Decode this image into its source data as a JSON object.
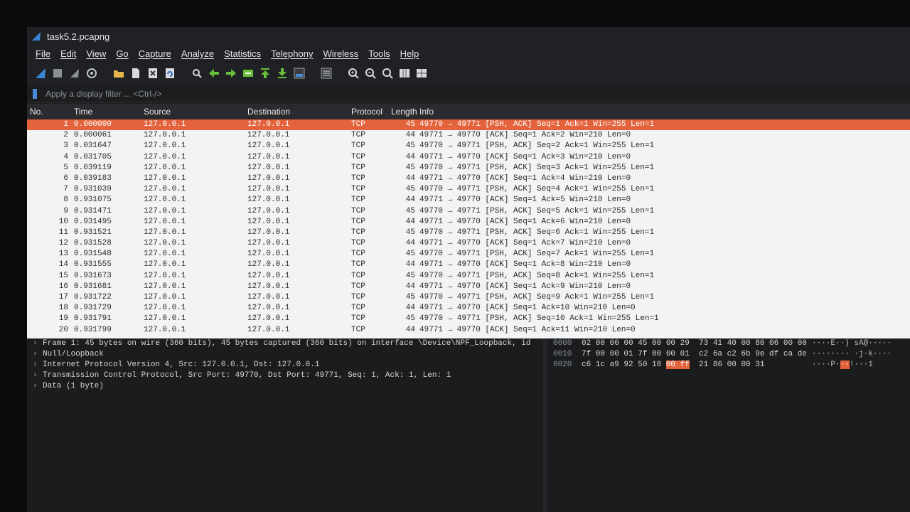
{
  "window": {
    "title": "task5.2.pcapng"
  },
  "menu": [
    "File",
    "Edit",
    "View",
    "Go",
    "Capture",
    "Analyze",
    "Statistics",
    "Telephony",
    "Wireless",
    "Tools",
    "Help"
  ],
  "toolbar": {
    "icons": [
      "shark-fin-start-icon",
      "stop-icon",
      "restart-icon",
      "options-icon",
      "open-folder-icon",
      "save-file-icon",
      "close-file-icon",
      "reload-icon",
      "find-icon",
      "back-arrow-icon",
      "forward-arrow-icon",
      "go-to-packet-icon",
      "first-packet-icon",
      "last-packet-icon",
      "autoscroll-icon",
      "colorize-icon",
      "zoom-in-icon",
      "zoom-out-icon",
      "normal-size-icon",
      "resize-columns-icon",
      "expand-icon"
    ]
  },
  "filter": {
    "placeholder": "Apply a display filter ... <Ctrl-/>"
  },
  "columns": {
    "no": "No.",
    "time": "Time",
    "source": "Source",
    "destination": "Destination",
    "protocol": "Protocol",
    "length": "Length",
    "info": "Info"
  },
  "packets": [
    {
      "no": "1",
      "time": "0.000000",
      "src": "127.0.0.1",
      "dst": "127.0.0.1",
      "proto": "TCP",
      "len": "45",
      "info": "49770 → 49771 [PSH, ACK] Seq=1 Ack=1 Win=255 Len=1"
    },
    {
      "no": "2",
      "time": "0.000061",
      "src": "127.0.0.1",
      "dst": "127.0.0.1",
      "proto": "TCP",
      "len": "44",
      "info": "49771 → 49770 [ACK] Seq=1 Ack=2 Win=210 Len=0"
    },
    {
      "no": "3",
      "time": "0.031647",
      "src": "127.0.0.1",
      "dst": "127.0.0.1",
      "proto": "TCP",
      "len": "45",
      "info": "49770 → 49771 [PSH, ACK] Seq=2 Ack=1 Win=255 Len=1"
    },
    {
      "no": "4",
      "time": "0.031705",
      "src": "127.0.0.1",
      "dst": "127.0.0.1",
      "proto": "TCP",
      "len": "44",
      "info": "49771 → 49770 [ACK] Seq=1 Ack=3 Win=210 Len=0"
    },
    {
      "no": "5",
      "time": "0.039119",
      "src": "127.0.0.1",
      "dst": "127.0.0.1",
      "proto": "TCP",
      "len": "45",
      "info": "49770 → 49771 [PSH, ACK] Seq=3 Ack=1 Win=255 Len=1"
    },
    {
      "no": "6",
      "time": "0.039183",
      "src": "127.0.0.1",
      "dst": "127.0.0.1",
      "proto": "TCP",
      "len": "44",
      "info": "49771 → 49770 [ACK] Seq=1 Ack=4 Win=210 Len=0"
    },
    {
      "no": "7",
      "time": "0.931039",
      "src": "127.0.0.1",
      "dst": "127.0.0.1",
      "proto": "TCP",
      "len": "45",
      "info": "49770 → 49771 [PSH, ACK] Seq=4 Ack=1 Win=255 Len=1"
    },
    {
      "no": "8",
      "time": "0.931075",
      "src": "127.0.0.1",
      "dst": "127.0.0.1",
      "proto": "TCP",
      "len": "44",
      "info": "49771 → 49770 [ACK] Seq=1 Ack=5 Win=210 Len=0"
    },
    {
      "no": "9",
      "time": "0.931471",
      "src": "127.0.0.1",
      "dst": "127.0.0.1",
      "proto": "TCP",
      "len": "45",
      "info": "49770 → 49771 [PSH, ACK] Seq=5 Ack=1 Win=255 Len=1"
    },
    {
      "no": "10",
      "time": "0.931495",
      "src": "127.0.0.1",
      "dst": "127.0.0.1",
      "proto": "TCP",
      "len": "44",
      "info": "49771 → 49770 [ACK] Seq=1 Ack=6 Win=210 Len=0"
    },
    {
      "no": "11",
      "time": "0.931521",
      "src": "127.0.0.1",
      "dst": "127.0.0.1",
      "proto": "TCP",
      "len": "45",
      "info": "49770 → 49771 [PSH, ACK] Seq=6 Ack=1 Win=255 Len=1"
    },
    {
      "no": "12",
      "time": "0.931528",
      "src": "127.0.0.1",
      "dst": "127.0.0.1",
      "proto": "TCP",
      "len": "44",
      "info": "49771 → 49770 [ACK] Seq=1 Ack=7 Win=210 Len=0"
    },
    {
      "no": "13",
      "time": "0.931548",
      "src": "127.0.0.1",
      "dst": "127.0.0.1",
      "proto": "TCP",
      "len": "45",
      "info": "49770 → 49771 [PSH, ACK] Seq=7 Ack=1 Win=255 Len=1"
    },
    {
      "no": "14",
      "time": "0.931555",
      "src": "127.0.0.1",
      "dst": "127.0.0.1",
      "proto": "TCP",
      "len": "44",
      "info": "49771 → 49770 [ACK] Seq=1 Ack=8 Win=210 Len=0"
    },
    {
      "no": "15",
      "time": "0.931673",
      "src": "127.0.0.1",
      "dst": "127.0.0.1",
      "proto": "TCP",
      "len": "45",
      "info": "49770 → 49771 [PSH, ACK] Seq=8 Ack=1 Win=255 Len=1"
    },
    {
      "no": "16",
      "time": "0.931681",
      "src": "127.0.0.1",
      "dst": "127.0.0.1",
      "proto": "TCP",
      "len": "44",
      "info": "49771 → 49770 [ACK] Seq=1 Ack=9 Win=210 Len=0"
    },
    {
      "no": "17",
      "time": "0.931722",
      "src": "127.0.0.1",
      "dst": "127.0.0.1",
      "proto": "TCP",
      "len": "45",
      "info": "49770 → 49771 [PSH, ACK] Seq=9 Ack=1 Win=255 Len=1"
    },
    {
      "no": "18",
      "time": "0.931729",
      "src": "127.0.0.1",
      "dst": "127.0.0.1",
      "proto": "TCP",
      "len": "44",
      "info": "49771 → 49770 [ACK] Seq=1 Ack=10 Win=210 Len=0"
    },
    {
      "no": "19",
      "time": "0.931791",
      "src": "127.0.0.1",
      "dst": "127.0.0.1",
      "proto": "TCP",
      "len": "45",
      "info": "49770 → 49771 [PSH, ACK] Seq=10 Ack=1 Win=255 Len=1"
    },
    {
      "no": "20",
      "time": "0.931799",
      "src": "127.0.0.1",
      "dst": "127.0.0.1",
      "proto": "TCP",
      "len": "44",
      "info": "49771 → 49770 [ACK] Seq=1 Ack=11 Win=210 Len=0"
    }
  ],
  "selected_packet": "1",
  "details": [
    "Frame 1: 45 bytes on wire (360 bits), 45 bytes captured (360 bits) on interface \\Device\\NPF_Loopback, id",
    "Null/Loopback",
    "Internet Protocol Version 4, Src: 127.0.0.1, Dst: 127.0.0.1",
    "Transmission Control Protocol, Src Port: 49770, Dst Port: 49771, Seq: 1, Ack: 1, Len: 1",
    "Data (1 byte)"
  ],
  "hex": [
    {
      "offset": "0000",
      "bytes_a": "02 00 00 00 45 00 00 29",
      "bytes_b": "73 41 40 00 80 06 00 00",
      "ascii": "····E··) sA@·····"
    },
    {
      "offset": "0010",
      "bytes_a": "7f 00 00 01 7f 00 00 01",
      "bytes_b": "c2 6a c2 6b 9e df ca de",
      "ascii": "········ ·j·k····"
    },
    {
      "offset": "0020",
      "bytes_a": "c6 1c a9 92 50 18",
      "bytes_hl": "00 ff",
      "bytes_b": "21 86 00 00 31",
      "ascii_a": "····P·",
      "ascii_hl": "··",
      "ascii_b": "!···1"
    }
  ],
  "colors": {
    "selection": "#e3633c",
    "list_bg": "#f1f3f4",
    "dark_bg": "#1e1f21"
  }
}
